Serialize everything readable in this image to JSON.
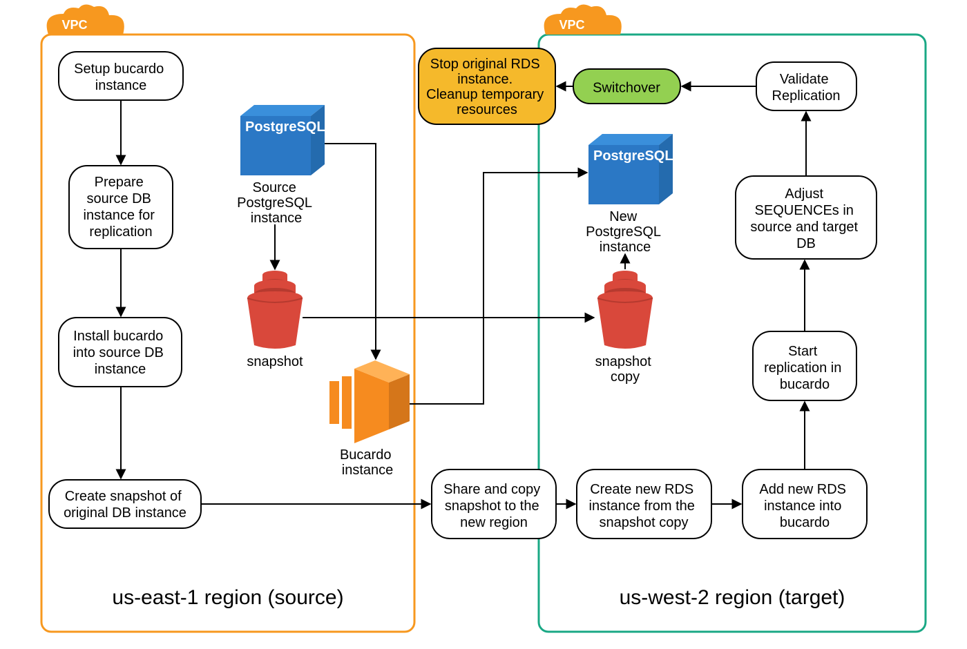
{
  "colors": {
    "source_border": "#F7981F",
    "target_border": "#1AA885",
    "vpc_cloud": "#F7981F",
    "db_blue": "#2B78C5",
    "ec2_orange": "#F68B1F",
    "snapshot_red": "#D9483B",
    "switch_green": "#93D051",
    "stop_yellow": "#F5B92B"
  },
  "labels": {
    "vpc": "VPC",
    "source_region": "us-east-1 region (source)",
    "target_region": "us-west-2 region (target)",
    "db_product": "PostgreSQL",
    "source_db": "Source\nPostgreSQL\ninstance",
    "target_db": "New\nPostgreSQL\ninstance",
    "snapshot": "snapshot",
    "snapshot_copy": "snapshot\ncopy",
    "bucardo_ec2": "Bucardo\ninstance"
  },
  "steps": {
    "setup_bucardo": "Setup bucardo\ninstance",
    "prepare_source": "Prepare\nsource DB\ninstance for\nreplication",
    "install_bucardo": "Install bucardo\ninto source DB\ninstance",
    "create_snapshot": "Create snapshot of\noriginal DB instance",
    "share_copy": "Share and copy\nsnapshot to the\nnew region",
    "create_rds": "Create new RDS\ninstance from the\nsnapshot copy",
    "add_rds": "Add new RDS\ninstance into\nbucardo",
    "start_repl": "Start\nreplication in\nbucardo",
    "adjust_seq": "Adjust\nSEQUENCEs in\nsource and target\nDB",
    "validate": "Validate\nReplication",
    "switchover": "Switchover",
    "stop_cleanup": "Stop original RDS\ninstance.\nCleanup temporary\nresources"
  }
}
